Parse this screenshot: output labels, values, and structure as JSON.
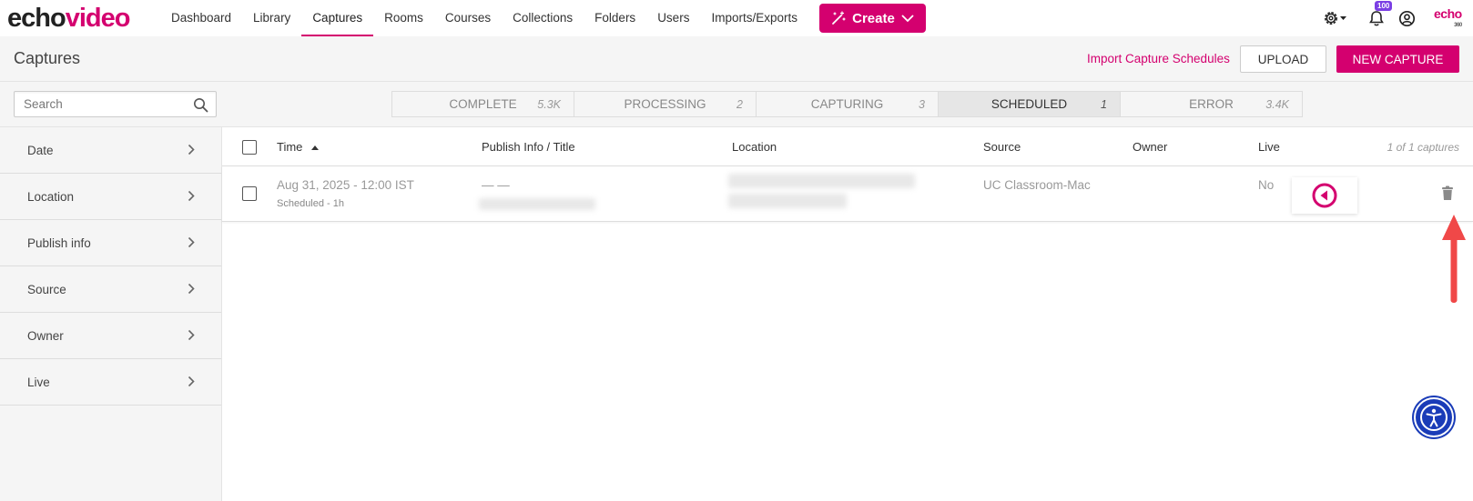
{
  "brand": {
    "logo_a": "echo",
    "logo_b": "video",
    "corner_logo": "echo",
    "corner_logo_sub": "360"
  },
  "nav": {
    "items": [
      {
        "label": "Dashboard"
      },
      {
        "label": "Library"
      },
      {
        "label": "Captures",
        "active": true
      },
      {
        "label": "Rooms"
      },
      {
        "label": "Courses"
      },
      {
        "label": "Collections"
      },
      {
        "label": "Folders"
      },
      {
        "label": "Users"
      },
      {
        "label": "Imports/Exports"
      }
    ],
    "create_label": "Create",
    "notification_count": "100"
  },
  "header": {
    "title": "Captures",
    "import_link": "Import Capture Schedules",
    "upload_label": "UPLOAD",
    "new_capture_label": "NEW CAPTURE"
  },
  "search": {
    "placeholder": "Search"
  },
  "status_tabs": [
    {
      "label": "COMPLETE",
      "count": "5.3K"
    },
    {
      "label": "PROCESSING",
      "count": "2"
    },
    {
      "label": "CAPTURING",
      "count": "3"
    },
    {
      "label": "SCHEDULED",
      "count": "1",
      "active": true
    },
    {
      "label": "ERROR",
      "count": "3.4K"
    }
  ],
  "filters": [
    {
      "label": "Date"
    },
    {
      "label": "Location"
    },
    {
      "label": "Publish info"
    },
    {
      "label": "Source"
    },
    {
      "label": "Owner"
    },
    {
      "label": "Live"
    }
  ],
  "table": {
    "headers": {
      "time": "Time",
      "publish": "Publish Info / Title",
      "location": "Location",
      "source": "Source",
      "owner": "Owner",
      "live": "Live"
    },
    "count_text": "1 of 1 captures",
    "rows": [
      {
        "time": "Aug 31, 2025 - 12:00 IST",
        "status": "Scheduled - 1h",
        "publish": "— —",
        "source": "UC Classroom-Mac",
        "live": "No"
      }
    ]
  },
  "colors": {
    "accent": "#d4006f",
    "arrow": "#f04848",
    "accessibility": "#1a3cb8"
  }
}
